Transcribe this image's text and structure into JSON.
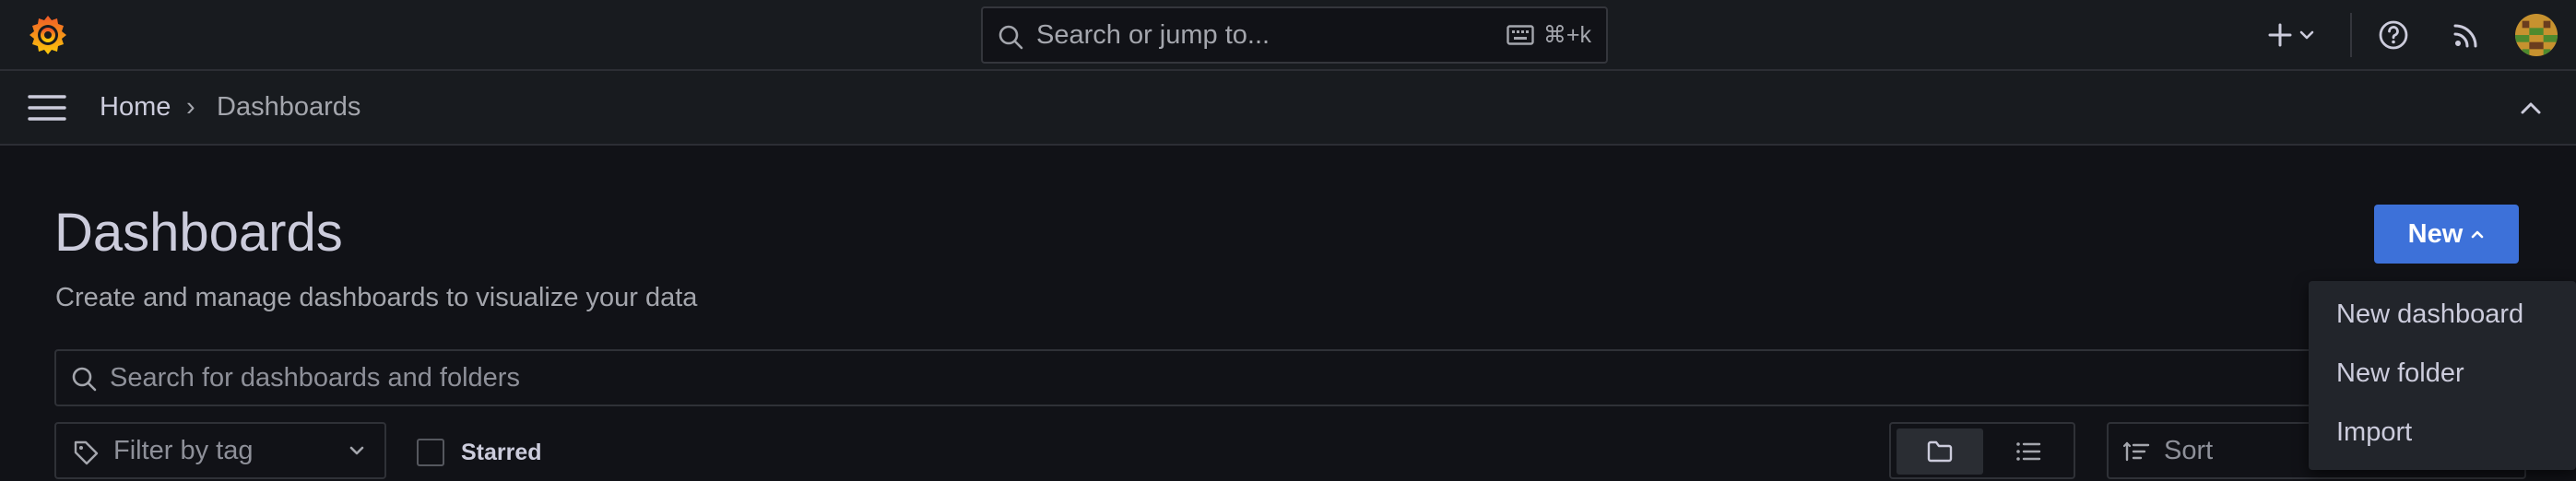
{
  "topbar": {
    "search_placeholder": "Search or jump to...",
    "search_shortcut": "⌘+k",
    "brand_color": "#f46800"
  },
  "breadcrumb": {
    "home": "Home",
    "separator": "›",
    "current": "Dashboards"
  },
  "page": {
    "title": "Dashboards",
    "subtitle": "Create and manage dashboards to visualize your data",
    "new_button_label": "New",
    "primary_color": "#3d71d9"
  },
  "filters": {
    "search_placeholder": "Search for dashboards and folders",
    "tag_placeholder": "Filter by tag",
    "starred_label": "Starred",
    "sort_placeholder": "Sort"
  },
  "new_menu": {
    "items": [
      "New dashboard",
      "New folder",
      "Import"
    ]
  },
  "icons": {
    "logo": "grafana-logo-icon",
    "search": "search-icon",
    "keyboard": "keyboard-icon",
    "add": "plus-icon",
    "help": "help-circle-icon",
    "news": "rss-icon",
    "menu": "hamburger-menu-icon",
    "collapse": "chevron-up-icon",
    "tag": "tag-icon",
    "folder_view": "folder-icon",
    "list_view": "list-icon",
    "sort": "sort-icon"
  }
}
